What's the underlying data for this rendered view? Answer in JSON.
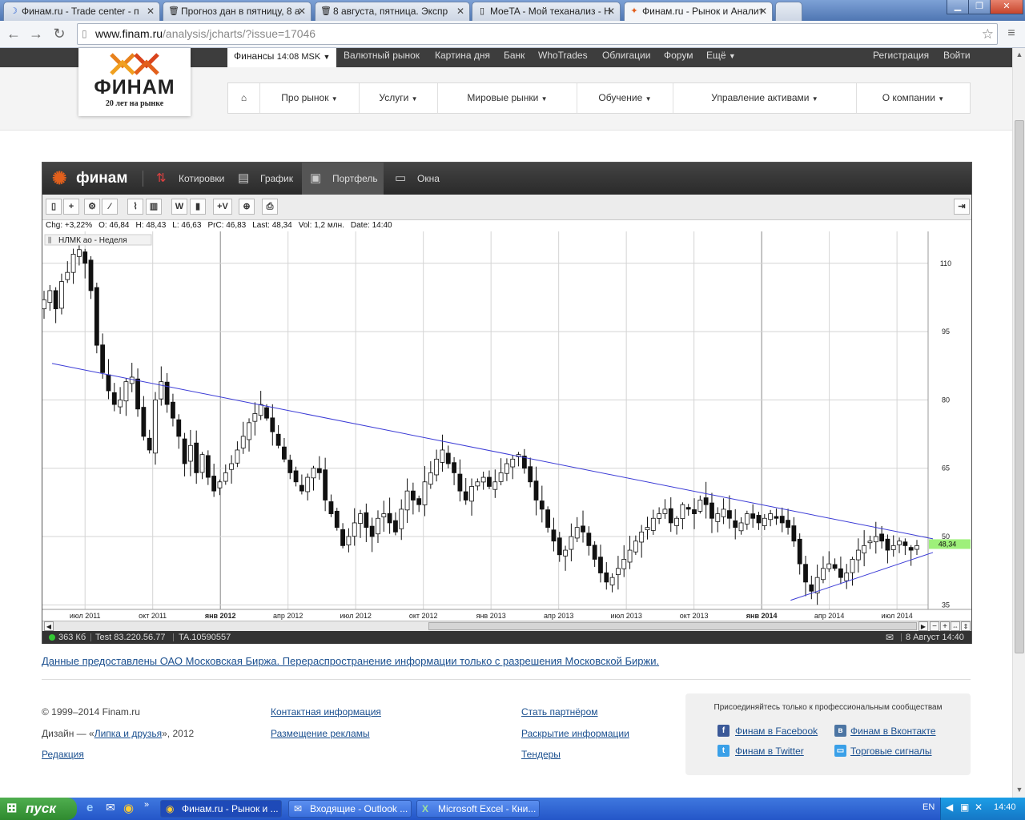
{
  "browser": {
    "tabs": [
      {
        "label": "Финам.ru - Trade center - п",
        "active": false
      },
      {
        "label": "Прогноз дан в пятницу, 8 а",
        "active": false
      },
      {
        "label": "8 августа, пятница. Экспр",
        "active": false
      },
      {
        "label": "MoeTA - Мой теханализ - Н",
        "active": false
      },
      {
        "label": "Финам.ru - Рынок и Аналит",
        "active": true
      }
    ],
    "url_host": "www.finam.ru",
    "url_path": "/analysis/jcharts/?issue=17046"
  },
  "site": {
    "top_nav": {
      "finance_label": "Финансы",
      "time": "14:08 MSK",
      "items": [
        "Валютный рынок",
        "Картина дня",
        "Банк",
        "WhoTrades",
        "Облигации",
        "Форум",
        "Ещё"
      ],
      "register": "Регистрация",
      "login": "Войти"
    },
    "logo": {
      "name": "ФИНАМ",
      "tagline": "20 лет на рынке"
    },
    "main_nav": [
      "Про рынок",
      "Услуги",
      "Мировые рынки",
      "Обучение",
      "Управление активами",
      "О компании"
    ]
  },
  "widget": {
    "logo": "финам",
    "tabs": [
      "Котировки",
      "График",
      "Портфель",
      "Окна"
    ],
    "toolbar_labels": {
      "w": "W",
      "v": "+V"
    },
    "info": {
      "chg": "Chg: +3,22%",
      "o": "O: 46,84",
      "h": "H: 48,43",
      "l": "L: 46,63",
      "prc": "PrC: 46,83",
      "last": "Last: 48,34",
      "vol": "Vol: 1,2 млн.",
      "date": "Date: 14:40"
    },
    "instrument": "НЛМК ао - Неделя",
    "last_price_label": "48,34",
    "status": {
      "size": "363 Кб",
      "test": "Test 83.220.56.77",
      "ta": "TA.10590557",
      "datetime": "8 Август 14:40"
    }
  },
  "chart_data": {
    "type": "candlestick",
    "x_labels": [
      {
        "label": "июл 2011",
        "bold": false
      },
      {
        "label": "окт 2011",
        "bold": false
      },
      {
        "label": "янв 2012",
        "bold": true
      },
      {
        "label": "апр 2012",
        "bold": false
      },
      {
        "label": "июл 2012",
        "bold": false
      },
      {
        "label": "окт 2012",
        "bold": false
      },
      {
        "label": "янв 2013",
        "bold": false
      },
      {
        "label": "апр 2013",
        "bold": false
      },
      {
        "label": "июл 2013",
        "bold": false
      },
      {
        "label": "окт 2013",
        "bold": false
      },
      {
        "label": "янв 2014",
        "bold": true
      },
      {
        "label": "апр 2014",
        "bold": false
      },
      {
        "label": "июл 2014",
        "bold": false
      }
    ],
    "y_ticks": [
      35,
      50,
      65,
      80,
      95,
      110
    ],
    "ylim": [
      34,
      117
    ],
    "last_price": 48.34,
    "trendlines": [
      {
        "from": [
          "2011-05",
          88
        ],
        "to": [
          "2014-08",
          49.5
        ],
        "color": "#3b3bd6"
      },
      {
        "from": [
          "2014-02",
          36
        ],
        "to": [
          "2014-08",
          46.5
        ],
        "color": "#3b3bd6"
      }
    ],
    "price_path_weekly_close": [
      102,
      104,
      100,
      106,
      108,
      112,
      113,
      110,
      104,
      92,
      86,
      82,
      79,
      80,
      84,
      85,
      78,
      72,
      69,
      80,
      84,
      79,
      76,
      72,
      66,
      70,
      64,
      68,
      63,
      60,
      62,
      64,
      66,
      69,
      72,
      75,
      77,
      79,
      76,
      73,
      70,
      67,
      64,
      62,
      60,
      63,
      65,
      64,
      58,
      55,
      52,
      48,
      50,
      53,
      55,
      52,
      50,
      54,
      55,
      53,
      51,
      56,
      60,
      58,
      57,
      62,
      64,
      67,
      69,
      66,
      64,
      60,
      58,
      61,
      62,
      63,
      61,
      62,
      64,
      66,
      67,
      68,
      65,
      62,
      58,
      56,
      52,
      49,
      46,
      47,
      50,
      52,
      51,
      48,
      45,
      42,
      40,
      41,
      43,
      45,
      47,
      49,
      51,
      52,
      54,
      55,
      56,
      53,
      54,
      57,
      56,
      55,
      58,
      57,
      54,
      55,
      56,
      54,
      52,
      53,
      55,
      54,
      53,
      54,
      55,
      54,
      53,
      52,
      49,
      44,
      40,
      38,
      41,
      43,
      44,
      43,
      41,
      42,
      45,
      47,
      48,
      49,
      50,
      49,
      47,
      48,
      49,
      48,
      47,
      48
    ]
  },
  "footer": {
    "disclaimer": "Данные предоставлены ОАО Московская Биржа. Перераспространение информации только с разрешения Московской Биржи.",
    "copyright": "© 1999–2014 Finam.ru",
    "design_prefix": "Дизайн — «",
    "design_link": "Липка и друзья",
    "design_suffix": "», 2012",
    "editorial": "Редакция",
    "col2": [
      "Контактная информация",
      "Размещение рекламы"
    ],
    "col3": [
      "Стать партнёром",
      "Раскрытие информации",
      "Тендеры"
    ],
    "social_title": "Присоединяйтесь только к профессиональным сообществам",
    "social": [
      {
        "label": "Финам в Facebook",
        "icon": "facebook-icon",
        "color": "#3b5998"
      },
      {
        "label": "Финам в Вконтакте",
        "icon": "vk-icon",
        "color": "#4c75a3"
      },
      {
        "label": "Финам в Twitter",
        "icon": "twitter-icon",
        "color": "#3aa0e8"
      },
      {
        "label": "Торговые сигналы",
        "icon": "signals-icon",
        "color": "#3aa0e8"
      }
    ]
  },
  "taskbar": {
    "start": "пуск",
    "tasks": [
      "Финам.ru - Рынок и ...",
      "Входящие - Outlook ...",
      "Microsoft Excel - Кни..."
    ],
    "lang": "EN",
    "clock": "14:40"
  }
}
